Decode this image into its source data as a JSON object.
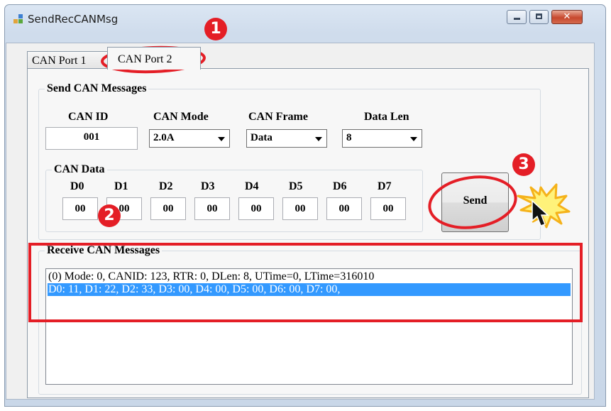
{
  "window": {
    "title": "SendRecCANMsg",
    "close_glyph": "✕"
  },
  "tabs": [
    {
      "label": "CAN Port 1"
    },
    {
      "label": "CAN Port 2"
    }
  ],
  "send_group": {
    "legend": "Send CAN Messages",
    "can_id": {
      "label": "CAN ID",
      "value": "001"
    },
    "can_mode": {
      "label": "CAN Mode",
      "value": "2.0A"
    },
    "can_frame": {
      "label": "CAN Frame",
      "value": "Data"
    },
    "data_len": {
      "label": "Data Len",
      "value": "8"
    },
    "can_data": {
      "legend": "CAN Data",
      "bytes": [
        {
          "label": "D0",
          "value": "00"
        },
        {
          "label": "D1",
          "value": "00"
        },
        {
          "label": "D2",
          "value": "00"
        },
        {
          "label": "D3",
          "value": "00"
        },
        {
          "label": "D4",
          "value": "00"
        },
        {
          "label": "D5",
          "value": "00"
        },
        {
          "label": "D6",
          "value": "00"
        },
        {
          "label": "D7",
          "value": "00"
        }
      ]
    },
    "send_label": "Send"
  },
  "receive_group": {
    "legend": "Receive CAN Messages",
    "rows": [
      "(0) Mode: 0, CANID: 123, RTR: 0, DLen: 8, UTime=0, LTime=316010",
      "D0: 11, D1: 22, D2: 33, D3: 00, D4: 00, D5: 00, D6: 00, D7: 00,"
    ]
  },
  "annotations": {
    "step1": "1",
    "step2": "2",
    "step3": "3",
    "color": "#e41e26"
  },
  "icons": [
    "app-icon",
    "minimize-icon",
    "maximize-icon",
    "close-icon",
    "dropdown-arrow-icon",
    "mouse-cursor-icon",
    "click-burst-icon"
  ]
}
